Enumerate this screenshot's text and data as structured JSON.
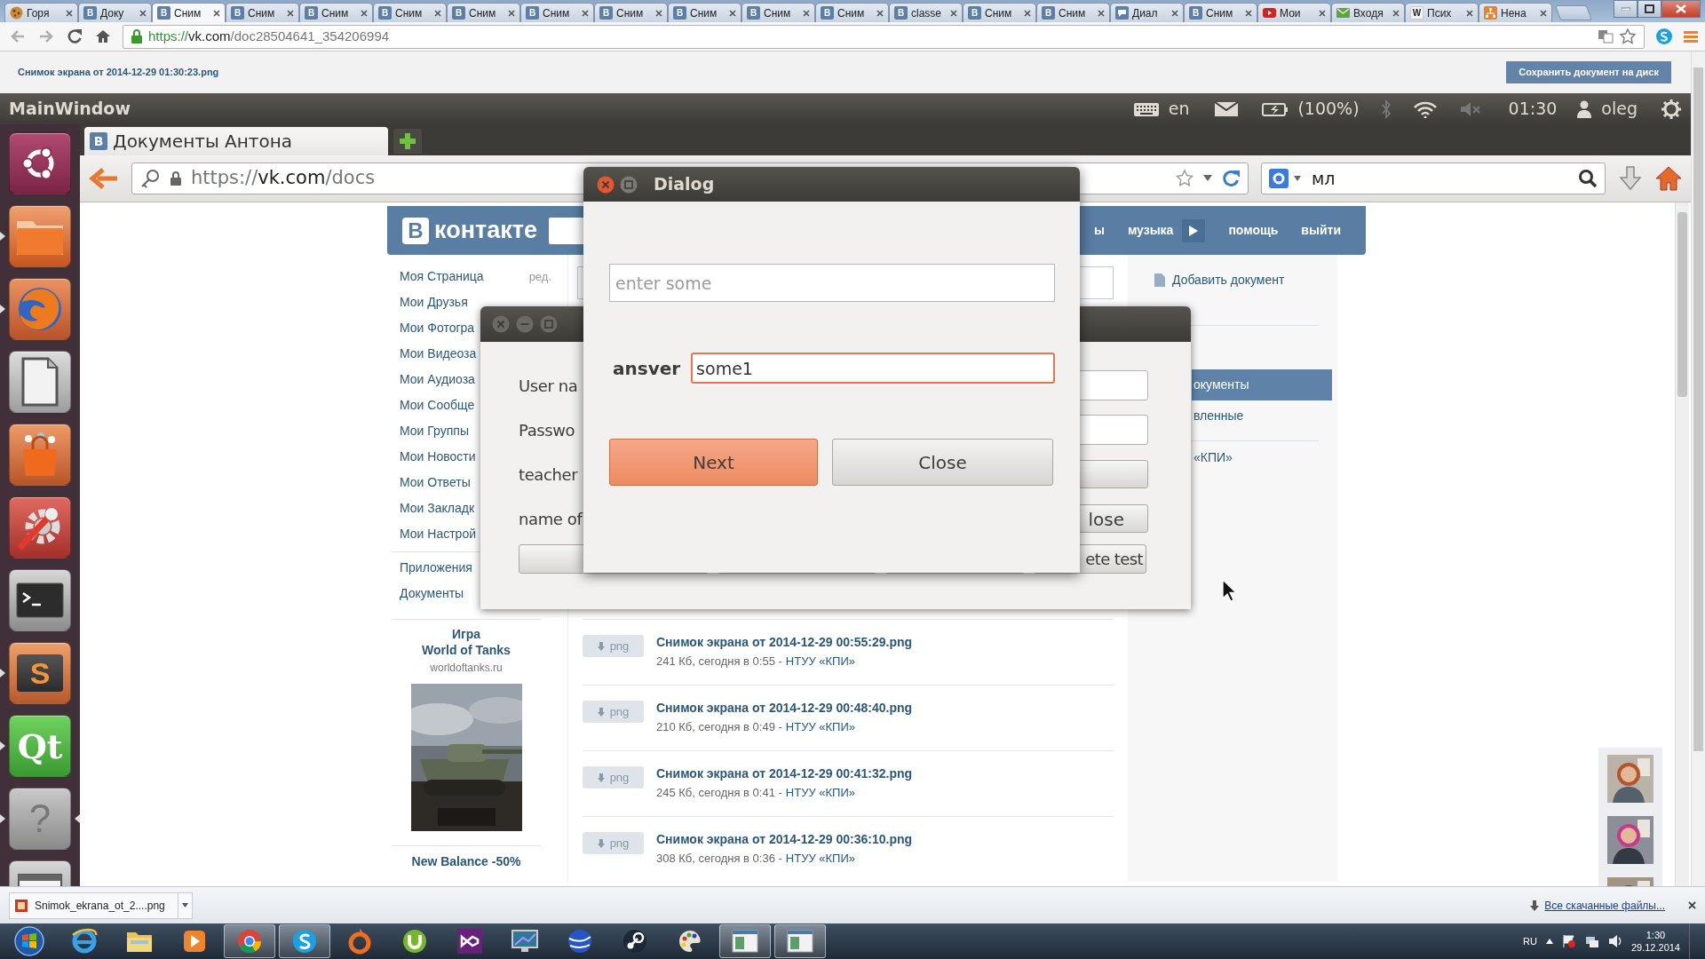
{
  "browser": {
    "tabs": [
      {
        "kind": "cookie",
        "label": "Горя",
        "selected": false
      },
      {
        "kind": "letter",
        "icon_text": "В",
        "label": "Доку",
        "selected": false
      },
      {
        "kind": "letter",
        "icon_text": "В",
        "label": "Сним",
        "selected": true
      },
      {
        "kind": "letter",
        "icon_text": "В",
        "label": "Сним",
        "selected": false
      },
      {
        "kind": "letter",
        "icon_text": "В",
        "label": "Сним",
        "selected": false
      },
      {
        "kind": "letter",
        "icon_text": "В",
        "label": "Сним",
        "selected": false
      },
      {
        "kind": "letter",
        "icon_text": "В",
        "label": "Сним",
        "selected": false
      },
      {
        "kind": "letter",
        "icon_text": "В",
        "label": "Сним",
        "selected": false
      },
      {
        "kind": "letter",
        "icon_text": "В",
        "label": "Сним",
        "selected": false
      },
      {
        "kind": "letter",
        "icon_text": "В",
        "label": "Сним",
        "selected": false
      },
      {
        "kind": "letter",
        "icon_text": "В",
        "label": "Сним",
        "selected": false
      },
      {
        "kind": "letter",
        "icon_text": "В",
        "label": "Сним",
        "selected": false
      },
      {
        "kind": "letter",
        "icon_text": "В",
        "label": "classe",
        "selected": false
      },
      {
        "kind": "letter",
        "icon_text": "В",
        "label": "Сним",
        "selected": false
      },
      {
        "kind": "letter",
        "icon_text": "В",
        "label": "Сним",
        "selected": false
      },
      {
        "kind": "chat",
        "label": "Диал",
        "selected": false
      },
      {
        "kind": "letter",
        "icon_text": "В",
        "label": "Сним",
        "selected": false
      },
      {
        "kind": "video",
        "label": "Мои",
        "selected": false
      },
      {
        "kind": "mail",
        "label": "Входя",
        "selected": false
      },
      {
        "kind": "letter-plain",
        "icon_text": "W",
        "label": "Псих",
        "selected": false
      },
      {
        "kind": "sitemap",
        "label": "Нена",
        "selected": false
      }
    ],
    "url_scheme": "https://",
    "url_host": "vk.com",
    "url_path": "/doc28504641_354206994"
  },
  "document": {
    "title": "Снимок экрана от 2014-12-29 01:30:23.png",
    "save_button": "Сохранить документ на диск"
  },
  "ubuntu_panel": {
    "title": "MainWindow",
    "keyboard": "en",
    "battery": "(100%)",
    "time": "01:30",
    "user": "oleg"
  },
  "launcher": [
    {
      "kind": "ubuntu",
      "running": false,
      "focused": false
    },
    {
      "kind": "folder",
      "running": true,
      "focused": false
    },
    {
      "kind": "firefox",
      "running": true,
      "focused": false
    },
    {
      "kind": "document",
      "running": false,
      "focused": false
    },
    {
      "kind": "bag",
      "running": false,
      "focused": false
    },
    {
      "kind": "settings",
      "running": false,
      "focused": false
    },
    {
      "kind": "terminal",
      "running": false,
      "focused": false
    },
    {
      "kind": "sublime",
      "label": "S",
      "running": true,
      "focused": false
    },
    {
      "kind": "qt",
      "label": "Qt",
      "running": true,
      "focused": false
    },
    {
      "kind": "help",
      "label": "?",
      "running": true,
      "focused": true
    },
    {
      "kind": "window",
      "running": false,
      "focused": false
    }
  ],
  "firefox": {
    "tab": "Документы Антона",
    "tab_favicon": "В",
    "url_scheme": "https://",
    "url_host": "vk.com",
    "url_path": "/docs",
    "search": "мл"
  },
  "vk": {
    "logo_letter": "В",
    "logo_text": "контакте",
    "header_links": [
      "ы",
      "музыка",
      "помощь",
      "выйти"
    ],
    "menu": [
      {
        "label": "Моя Страница",
        "edit": "ред."
      },
      {
        "label": "Мои Друзья"
      },
      {
        "label": "Мои Фотогра"
      },
      {
        "label": "Мои Видеоза"
      },
      {
        "label": "Мои Аудиоза"
      },
      {
        "label": "Мои Сообще"
      },
      {
        "label": "Мои Группы"
      },
      {
        "label": "Мои Новости"
      },
      {
        "label": "Мои Ответы"
      },
      {
        "label": "Мои Закладк"
      },
      {
        "label": "Мои Настрой"
      }
    ],
    "menu_extra": [
      "Приложения",
      "Документы"
    ],
    "ad": {
      "lines": [
        "Игра",
        "World of Tanks"
      ],
      "domain": "worldoftanks.ru",
      "promo": "New Balance -50%"
    },
    "add_document": "Добавить документ",
    "filters": [
      {
        "label": "окументы",
        "selected": true
      },
      {
        "label": "вленные",
        "selected": false
      },
      {
        "label": "«КПИ»",
        "selected": false
      }
    ],
    "documents": [
      {
        "type": "png",
        "title": "Снимок экрана от 2014-12-29 00:55:29.png",
        "meta": "241 Кб, сегодня в 0:55 -",
        "group": "НТУУ «КПИ»"
      },
      {
        "type": "png",
        "title": "Снимок экрана от 2014-12-29 00:48:40.png",
        "meta": "210 Кб, сегодня в 0:49 -",
        "group": "НТУУ «КПИ»"
      },
      {
        "type": "png",
        "title": "Снимок экрана от 2014-12-29 00:41:32.png",
        "meta": "245 Кб, сегодня в 0:41 -",
        "group": "НТУУ «КПИ»"
      },
      {
        "type": "png",
        "title": "Снимок экрана от 2014-12-29 00:36:10.png",
        "meta": "308 Кб, сегодня в 0:36 -",
        "group": "НТУУ «КПИ»"
      }
    ]
  },
  "main_window": {
    "labels": [
      "User na",
      "Passwo",
      "teacher",
      "name of"
    ],
    "button_texts": [
      "lose",
      "ete test"
    ]
  },
  "dialog": {
    "title": "Dialog",
    "placeholder": "enter some",
    "answer_label": "ansver",
    "answer": "some1",
    "answer_focused": true,
    "buttons": [
      {
        "label": "Next",
        "default": true
      },
      {
        "label": "Close",
        "default": false
      }
    ]
  },
  "downloads": {
    "file": "Snimok_ekrana_ot_2....png",
    "show_all": "Все скачанные файлы..."
  },
  "taskbar": {
    "apps": [
      {
        "kind": "ie",
        "active": false
      },
      {
        "kind": "explorer",
        "active": false
      },
      {
        "kind": "media",
        "active": false
      },
      {
        "kind": "chrome",
        "active": true
      },
      {
        "kind": "skype",
        "active": true
      },
      {
        "kind": "origin",
        "active": false
      },
      {
        "kind": "torrent",
        "active": false
      },
      {
        "kind": "vs",
        "active": false
      },
      {
        "kind": "monitor",
        "active": false
      },
      {
        "kind": "earth",
        "active": false
      },
      {
        "kind": "steam",
        "active": false
      },
      {
        "kind": "paint",
        "active": false
      },
      {
        "kind": "window",
        "active": true
      },
      {
        "kind": "window",
        "active": true
      }
    ],
    "language": "RU",
    "time": "1:30",
    "date": "29.12.2014"
  }
}
